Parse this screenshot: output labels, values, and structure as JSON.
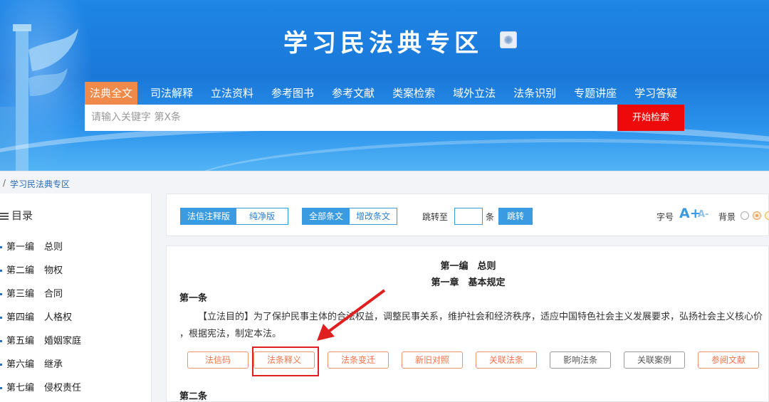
{
  "header": {
    "title": "学习民法典专区",
    "nav": [
      "法典全文",
      "司法解释",
      "立法资料",
      "参考图书",
      "参考文献",
      "类案检索",
      "域外立法",
      "法条识别",
      "专题讲座",
      "学习答疑"
    ],
    "search_placeholder": "请输入关键字 第X条",
    "search_button": "开始检索"
  },
  "breadcrumb": {
    "sep": "/",
    "current": "学习民法典专区"
  },
  "sidebar": {
    "heading": "目录",
    "items": [
      {
        "num": "第一编",
        "name": "总则"
      },
      {
        "num": "第二编",
        "name": "物权"
      },
      {
        "num": "第三编",
        "name": "合同"
      },
      {
        "num": "第四编",
        "name": "人格权"
      },
      {
        "num": "第五编",
        "name": "婚姻家庭"
      },
      {
        "num": "第六编",
        "name": "继承"
      },
      {
        "num": "第七编",
        "name": "侵权责任"
      }
    ]
  },
  "toolbar": {
    "version_on": "法信注释版",
    "version_off": "纯净版",
    "scope_on": "全部条文",
    "scope_off": "增改条文",
    "jump_label": "跳转至",
    "jump_unit": "条",
    "jump_button": "跳转",
    "font_label": "字号",
    "font_up": "A+",
    "font_down": "A-",
    "bg_label": "背景"
  },
  "content": {
    "part": "第一编　总则",
    "chapter": "第一章　基本规定",
    "article1_title": "第一条",
    "article1_line1": "【立法目的】为了保护民事主体的合法权益，调整民事关系，维护社会和经济秩序，适应中国特色社会主义发展要求，弘扬社会主义核心价",
    "article1_line2": "值观，根据宪法，制定本法。",
    "actions": [
      "法信码",
      "法条释义",
      "法条变迁",
      "新旧对照",
      "关联法条",
      "影响法条",
      "关联案例",
      "参阅文献"
    ],
    "article2_title": "第二条"
  }
}
